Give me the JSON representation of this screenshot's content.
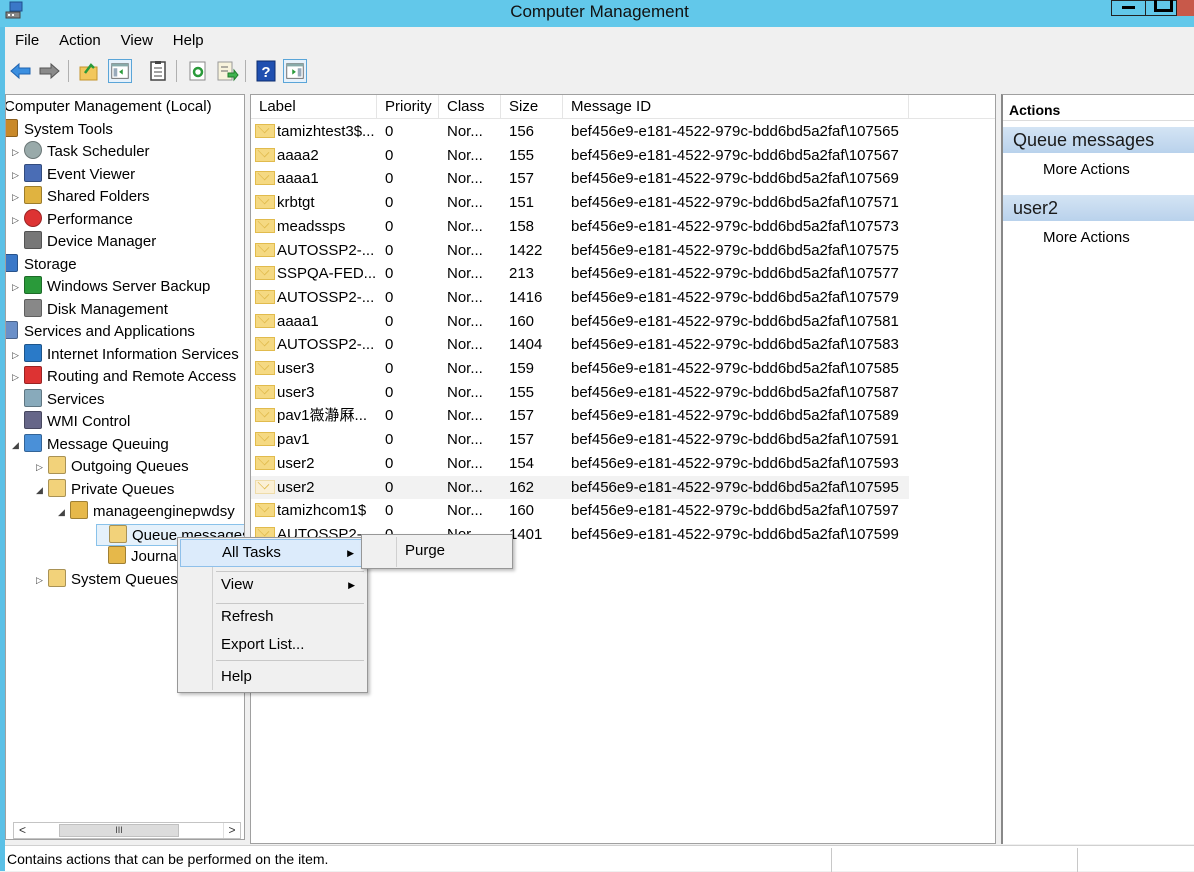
{
  "window": {
    "title": "Computer Management"
  },
  "menubar": [
    "File",
    "Action",
    "View",
    "Help"
  ],
  "toolbar": {
    "buttons": [
      "back-icon",
      "forward-icon",
      "up-folder-icon",
      "show-hide-tree-icon",
      "properties-icon",
      "refresh-icon",
      "export-list-icon",
      "help-icon",
      "show-hide-action-pane-icon"
    ]
  },
  "tree": {
    "items": [
      {
        "label": "Computer Management (Local)",
        "icon": "computer-management-icon",
        "level": 0,
        "expander": ""
      },
      {
        "label": "System Tools",
        "icon": "system-tools-icon",
        "level": 0,
        "expander": ""
      },
      {
        "label": "Task Scheduler",
        "icon": "clock-icon",
        "level": 1,
        "expander": "▷"
      },
      {
        "label": "Event Viewer",
        "icon": "event-viewer-icon",
        "level": 1,
        "expander": "▷"
      },
      {
        "label": "Shared Folders",
        "icon": "shared-folders-icon",
        "level": 1,
        "expander": "▷"
      },
      {
        "label": "Performance",
        "icon": "performance-icon",
        "level": 1,
        "expander": "▷"
      },
      {
        "label": "Device Manager",
        "icon": "device-manager-icon",
        "level": 1,
        "expander": ""
      },
      {
        "label": "Storage",
        "icon": "storage-icon",
        "level": 0,
        "expander": ""
      },
      {
        "label": "Windows Server Backup",
        "icon": "backup-icon",
        "level": 1,
        "expander": "▷"
      },
      {
        "label": "Disk Management",
        "icon": "disk-icon",
        "level": 1,
        "expander": ""
      },
      {
        "label": "Services and Applications",
        "icon": "services-apps-icon",
        "level": 0,
        "expander": ""
      },
      {
        "label": "Internet Information Services",
        "icon": "iis-icon",
        "level": 1,
        "expander": "▷"
      },
      {
        "label": "Routing and Remote Access",
        "icon": "routing-icon",
        "level": 1,
        "expander": "▷"
      },
      {
        "label": "Services",
        "icon": "gear-icon",
        "level": 1,
        "expander": ""
      },
      {
        "label": "WMI Control",
        "icon": "wmi-icon",
        "level": 1,
        "expander": ""
      },
      {
        "label": "Message Queuing",
        "icon": "message-queuing-icon",
        "level": 1,
        "expander": "◢"
      },
      {
        "label": "Outgoing Queues",
        "icon": "folder-icon",
        "level": 2,
        "expander": "▷"
      },
      {
        "label": "Private Queues",
        "icon": "folder-icon",
        "level": 2,
        "expander": "◢"
      },
      {
        "label": "manageenginepwdsy",
        "icon": "queue-icon",
        "level": 3,
        "expander": "◢"
      },
      {
        "label": "Queue messages",
        "icon": "queue-messages-icon",
        "level": 4,
        "expander": "",
        "selected": true
      },
      {
        "label": "Journal",
        "icon": "journal-icon",
        "level": 4,
        "expander": ""
      },
      {
        "label": "System Queues",
        "icon": "folder-icon",
        "level": 2,
        "expander": "▷"
      }
    ]
  },
  "list": {
    "columns": [
      "Label",
      "Priority",
      "Class",
      "Size",
      "Message ID"
    ],
    "rows": [
      [
        "tamizhtest3$...",
        "0",
        "Nor...",
        "156",
        "bef456e9-e181-4522-979c-bdd6bd5a2faf\\107565"
      ],
      [
        "aaaa2",
        "0",
        "Nor...",
        "155",
        "bef456e9-e181-4522-979c-bdd6bd5a2faf\\107567"
      ],
      [
        "aaaa1",
        "0",
        "Nor...",
        "157",
        "bef456e9-e181-4522-979c-bdd6bd5a2faf\\107569"
      ],
      [
        "krbtgt",
        "0",
        "Nor...",
        "151",
        "bef456e9-e181-4522-979c-bdd6bd5a2faf\\107571"
      ],
      [
        "meadssps",
        "0",
        "Nor...",
        "158",
        "bef456e9-e181-4522-979c-bdd6bd5a2faf\\107573"
      ],
      [
        "AUTOSSP2-...",
        "0",
        "Nor...",
        "1422",
        "bef456e9-e181-4522-979c-bdd6bd5a2faf\\107575"
      ],
      [
        "SSPQA-FED...",
        "0",
        "Nor...",
        "213",
        "bef456e9-e181-4522-979c-bdd6bd5a2faf\\107577"
      ],
      [
        "AUTOSSP2-...",
        "0",
        "Nor...",
        "1416",
        "bef456e9-e181-4522-979c-bdd6bd5a2faf\\107579"
      ],
      [
        "aaaa1",
        "0",
        "Nor...",
        "160",
        "bef456e9-e181-4522-979c-bdd6bd5a2faf\\107581"
      ],
      [
        "AUTOSSP2-...",
        "0",
        "Nor...",
        "1404",
        "bef456e9-e181-4522-979c-bdd6bd5a2faf\\107583"
      ],
      [
        "user3",
        "0",
        "Nor...",
        "159",
        "bef456e9-e181-4522-979c-bdd6bd5a2faf\\107585"
      ],
      [
        "user3",
        "0",
        "Nor...",
        "155",
        "bef456e9-e181-4522-979c-bdd6bd5a2faf\\107587"
      ],
      [
        "pav1嶶瀞厤...",
        "0",
        "Nor...",
        "157",
        "bef456e9-e181-4522-979c-bdd6bd5a2faf\\107589"
      ],
      [
        "pav1",
        "0",
        "Nor...",
        "157",
        "bef456e9-e181-4522-979c-bdd6bd5a2faf\\107591"
      ],
      [
        "user2",
        "0",
        "Nor...",
        "154",
        "bef456e9-e181-4522-979c-bdd6bd5a2faf\\107593"
      ],
      [
        "user2",
        "0",
        "Nor...",
        "162",
        "bef456e9-e181-4522-979c-bdd6bd5a2faf\\107595"
      ],
      [
        "tamizhcom1$",
        "0",
        "Nor...",
        "160",
        "bef456e9-e181-4522-979c-bdd6bd5a2faf\\107597"
      ],
      [
        "AUTOSSP2-...",
        "0",
        "Nor...",
        "1401",
        "bef456e9-e181-4522-979c-bdd6bd5a2faf\\107599"
      ]
    ],
    "hover_row": 15
  },
  "actions": {
    "title": "Actions",
    "sections": [
      {
        "title": "Queue messages",
        "items": [
          "More Actions"
        ]
      },
      {
        "title": "user2",
        "items": [
          "More Actions"
        ]
      }
    ]
  },
  "context_menu": {
    "items": [
      {
        "label": "All Tasks",
        "submenu": true,
        "highlighted": true
      },
      {
        "label": "View",
        "submenu": true
      },
      {
        "label": "Refresh"
      },
      {
        "label": "Export List..."
      },
      {
        "label": "Help"
      }
    ],
    "submenu_items": [
      "Purge"
    ]
  },
  "statusbar": {
    "text": "Contains actions that can be performed on the item."
  },
  "colors": {
    "titlebar": "#62c8ea",
    "close_button": "#c8594a",
    "selection": "#e5f1fb",
    "action_section": "#c5dbf1"
  }
}
